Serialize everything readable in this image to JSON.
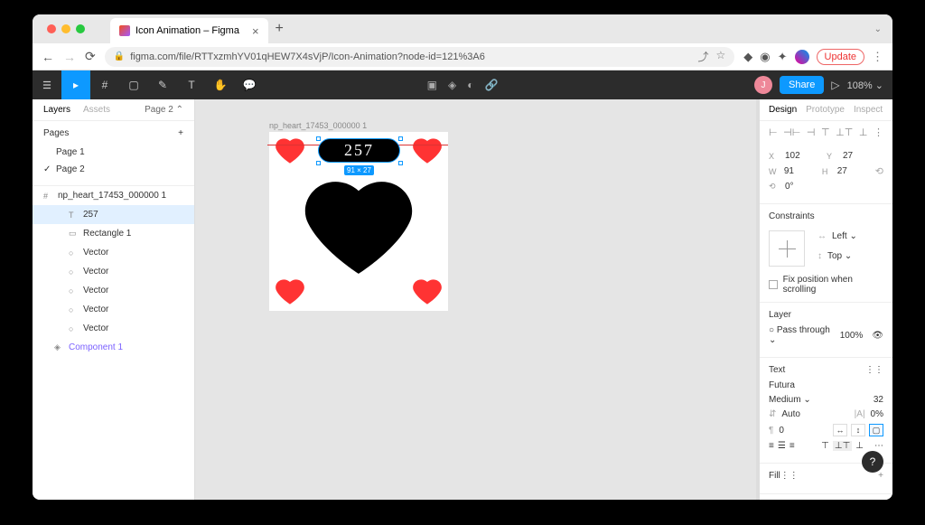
{
  "browser": {
    "tab_title": "Icon Animation – Figma",
    "url": "figma.com/file/RTTxzmhYV01qHEW7X4sVjP/Icon-Animation?node-id=121%3A6",
    "update_label": "Update"
  },
  "toolbar": {
    "avatar_initial": "J",
    "share_label": "Share",
    "zoom_label": "108%"
  },
  "left_panel": {
    "tabs": {
      "layers": "Layers",
      "assets": "Assets"
    },
    "page_selector": "Page 2",
    "pages_label": "Pages",
    "pages": [
      "Page 1",
      "Page 2"
    ],
    "frame_name": "np_heart_17453_000000 1",
    "layers": [
      {
        "name": "257",
        "icon": "T",
        "selected": true
      },
      {
        "name": "Rectangle 1",
        "icon": "▭"
      },
      {
        "name": "Vector",
        "icon": "○"
      },
      {
        "name": "Vector",
        "icon": "○"
      },
      {
        "name": "Vector",
        "icon": "○"
      },
      {
        "name": "Vector",
        "icon": "○"
      },
      {
        "name": "Vector",
        "icon": "○"
      }
    ],
    "component_name": "Component 1"
  },
  "canvas": {
    "frame_label": "np_heart_17453_000000 1",
    "count_text": "257",
    "dim_label": "91 × 27"
  },
  "right_panel": {
    "tabs": {
      "design": "Design",
      "prototype": "Prototype",
      "inspect": "Inspect"
    },
    "x": "102",
    "y": "27",
    "w": "91",
    "h": "27",
    "rotation": "0°",
    "constraints_label": "Constraints",
    "constraint_h": "Left",
    "constraint_v": "Top",
    "fix_label": "Fix position when scrolling",
    "layer_label": "Layer",
    "blend_mode": "Pass through",
    "opacity": "100%",
    "text_label": "Text",
    "font_family": "Futura",
    "font_weight": "Medium",
    "font_size": "32",
    "line_height": "Auto",
    "letter_spacing": "0%",
    "paragraph_spacing": "0",
    "fill_label": "Fill"
  }
}
